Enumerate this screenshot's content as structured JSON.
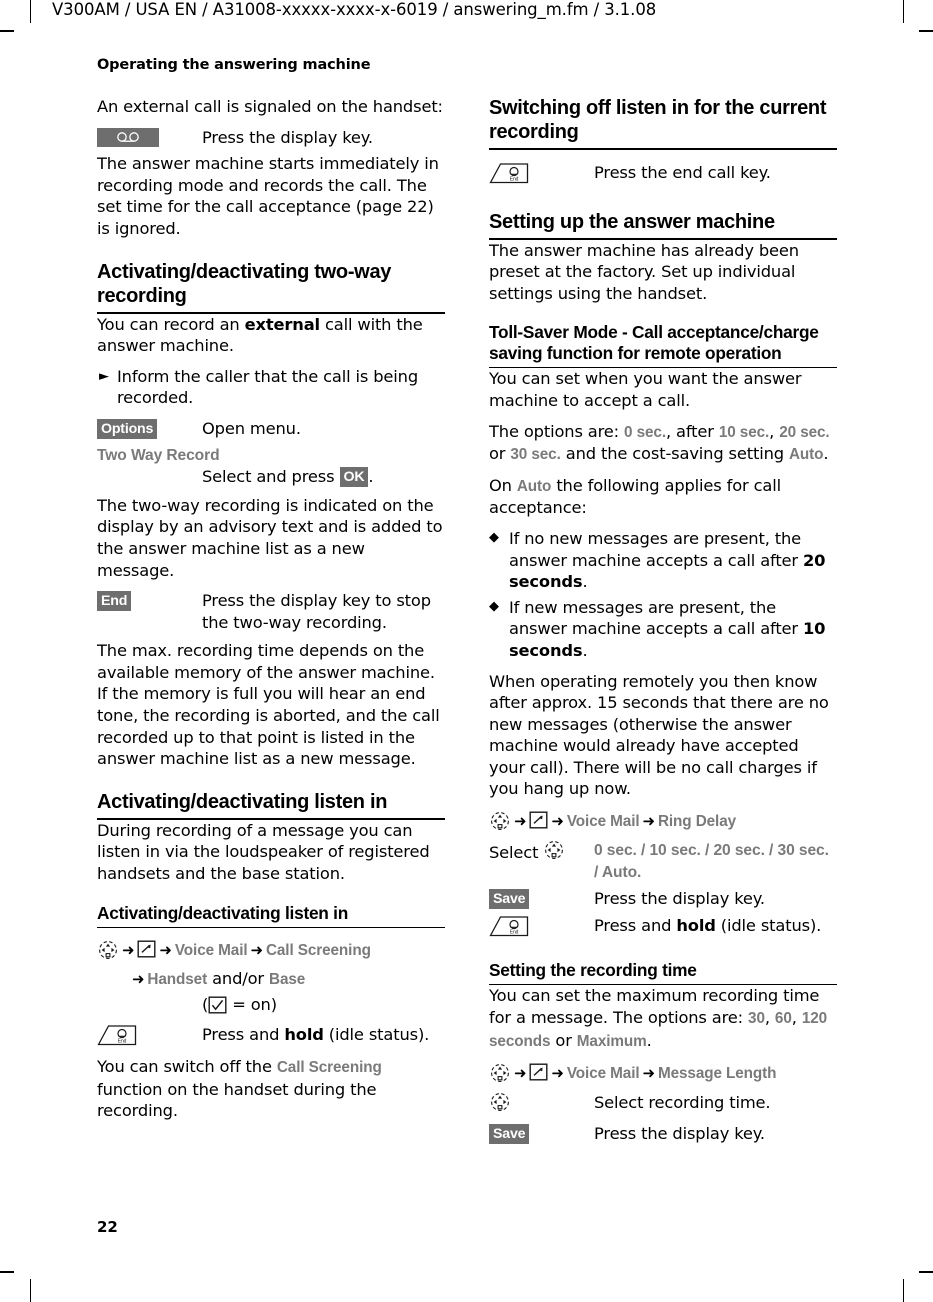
{
  "document": {
    "fm_header": "V300AM / USA EN / A31008-xxxxx-xxxx-x-6019 / answering_m.fm / 3.1.08",
    "chapter_title": "Operating the answering machine",
    "page_number": "22"
  },
  "colors": {
    "softkey_bg": "#6e6e6e",
    "softkey_text": "#ffffff",
    "menu_term": "#7a7a7a",
    "rule": "#000000"
  },
  "left_column": {
    "intro_paragraph": "An external call is signaled on the handset:",
    "step_display_key": {
      "key_icon": "answer-machine-tape-icon",
      "description": "Press the display key."
    },
    "paragraph_after_step": "The answer machine starts immediately in recording mode and records the call. The set time for the call acceptance (page 22) is ignored.",
    "section_two_way": {
      "heading": "Activating/deactivating two-way recording",
      "intro_a": "You can record an ",
      "intro_bold": "external",
      "intro_b": " call with the answer machine.",
      "bullet": "Inform the caller that the call is being recorded.",
      "step_options": {
        "softkey": "Options",
        "description": "Open menu."
      },
      "menu_item": "Two Way Record",
      "step_select": {
        "description_a": "Select and press ",
        "softkey": "OK",
        "description_b": "."
      },
      "paragraph_indication": "The two-way recording is indicated on the display by an advisory text and is added to the answer machine list as a new message.",
      "step_end": {
        "softkey": "End",
        "description": "Press the display key to stop the two-way recording."
      },
      "paragraph_memory": "The max. recording time depends on the available memory of the answer machine. If the memory is full you will hear an end tone, the recording is aborted, and the call recorded up to that point is listed in the answer machine list as a new message."
    },
    "section_listen_in": {
      "heading": "Activating/deactivating listen in",
      "intro": "During recording of a message you can listen in via the loudspeaker of registered handsets and the base station.",
      "subheading": "Activating/deactivating listen in",
      "nav_path": {
        "nav_icon": "control-key-icon",
        "arrow": "➜",
        "msg_icon": "messages-icon",
        "item1": "Voice Mail",
        "item2": "Call Screening",
        "item3_a": "Handset",
        "item3_mid": " and/or ",
        "item3_b": "Base",
        "checkbox_note_a": "(",
        "checkbox_icon": "checkbox-checked-icon",
        "checkbox_note_b": " = on)"
      },
      "step_end_key": {
        "key_icon": "end-call-key-icon",
        "description_a": "Press and ",
        "description_bold": "hold",
        "description_b": " (idle status)."
      },
      "closing_a": "You can switch off the ",
      "closing_term": "Call Screening",
      "closing_b": " function on the handset during the recording."
    }
  },
  "right_column": {
    "section_switch_off": {
      "heading": "Switching off listen in for the current recording",
      "step_end_key": {
        "key_icon": "end-call-key-icon",
        "description": "Press the end call key."
      }
    },
    "section_setting_up": {
      "heading": "Setting up the answer machine",
      "paragraph": "The answer machine has already been preset at the factory. Set up individual settings using the handset."
    },
    "section_toll_saver": {
      "heading": "Toll-Saver Mode - Call acceptance/charge saving function for remote operation",
      "paragraph_1": "You can set when you want the answer machine to accept a call.",
      "options_line": {
        "a": "The options are: ",
        "opt1": "0 sec.",
        "b": ", after ",
        "opt2": "10 sec.",
        "c": ", ",
        "opt3": "20 sec.",
        "d": " or ",
        "opt4": "30 sec.",
        "e": " and the cost-saving setting ",
        "opt5": "Auto",
        "f": "."
      },
      "auto_line": {
        "a": "On ",
        "term": "Auto",
        "b": " the following applies for call acceptance:"
      },
      "bullets": [
        {
          "text_a": "If no new messages are present, the answer machine accepts a call after ",
          "bold": "20 seconds",
          "text_b": "."
        },
        {
          "text_a": "If new messages are present, the answer machine accepts a call after ",
          "bold": "10 seconds",
          "text_b": "."
        }
      ],
      "paragraph_remote": "When operating remotely you then know after approx. 15 seconds that there are no new messages (otherwise the answer machine would already have accepted your call). There will be no call charges if you hang up now.",
      "nav_path": {
        "nav_icon": "control-key-icon",
        "arrow": "➜",
        "msg_icon": "messages-icon",
        "item1": "Voice Mail",
        "item2": "Ring Delay"
      },
      "step_select": {
        "label": "Select",
        "nav_icon": "control-key-icon",
        "options": "0 sec. / 10 sec. / 20 sec. / 30 sec. / Auto."
      },
      "step_save": {
        "softkey": "Save",
        "description": "Press the display key."
      },
      "step_end_key": {
        "key_icon": "end-call-key-icon",
        "description_a": "Press and ",
        "description_bold": "hold",
        "description_b": " (idle status)."
      }
    },
    "section_recording_time": {
      "heading": "Setting the recording time",
      "paragraph": {
        "a": "You can set the maximum recording time for a message. The options are: ",
        "opt1": "30",
        "b": ", ",
        "opt2": "60",
        "c": ", ",
        "opt3": "120 seconds",
        "d": " or ",
        "opt4": "Maximum",
        "e": "."
      },
      "nav_path": {
        "nav_icon": "control-key-icon",
        "arrow": "➜",
        "msg_icon": "messages-icon",
        "item1": "Voice Mail",
        "item2": "Message Length"
      },
      "step_select": {
        "nav_icon": "control-key-icon",
        "description": "Select recording time."
      },
      "step_save": {
        "softkey": "Save",
        "description": "Press the display key."
      }
    }
  }
}
